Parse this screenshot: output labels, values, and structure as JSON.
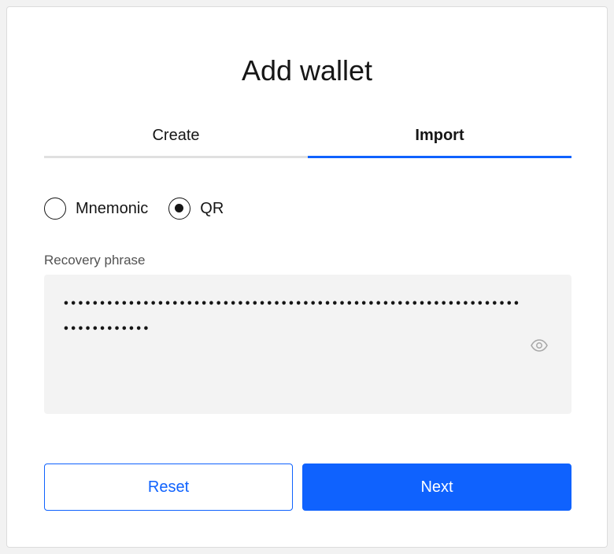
{
  "dialog": {
    "title": "Add wallet"
  },
  "tabs": [
    {
      "label": "Create",
      "active": false
    },
    {
      "label": "Import",
      "active": true
    }
  ],
  "import_method": {
    "options": [
      {
        "label": "Mnemonic",
        "checked": false
      },
      {
        "label": "QR",
        "checked": true
      }
    ]
  },
  "recovery": {
    "label": "Recovery phrase",
    "masked_value": "•••••••••••••••••••••••••••••••••••••••••••••••••••••••••••••••••••••••••••",
    "toggle_icon": "eye-icon"
  },
  "actions": {
    "reset_label": "Reset",
    "next_label": "Next"
  },
  "colors": {
    "accent": "#0f62fe",
    "text": "#161616",
    "field_bg": "#f3f3f3"
  }
}
